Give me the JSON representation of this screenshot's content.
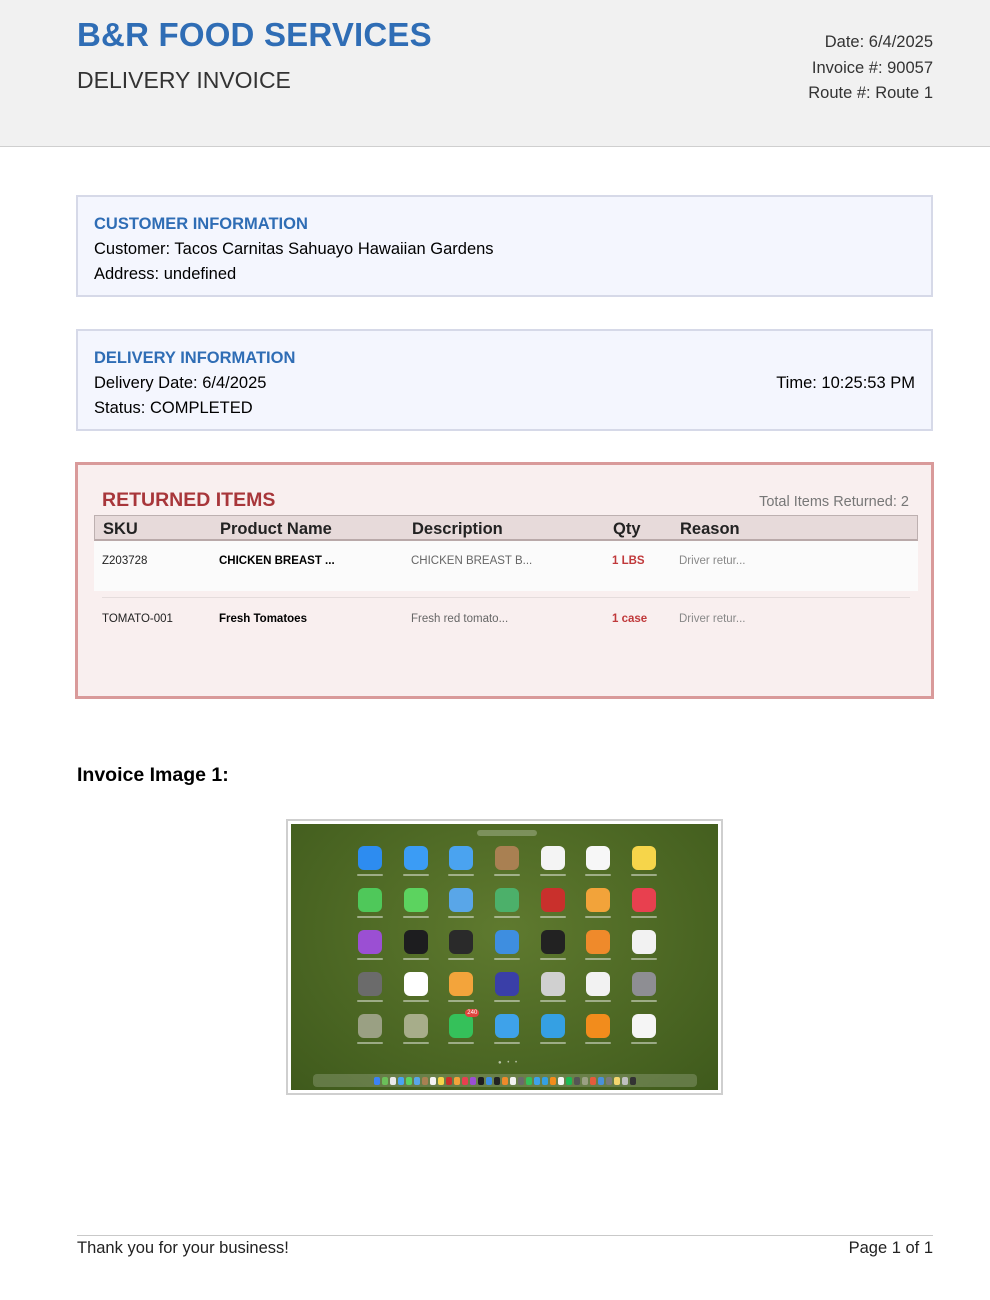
{
  "header": {
    "company": "B&R FOOD SERVICES",
    "document_type": "DELIVERY INVOICE",
    "date": "Date: 6/4/2025",
    "invoice": "Invoice #: 90057",
    "route": "Route #: Route 1"
  },
  "customer_info": {
    "title": "CUSTOMER INFORMATION",
    "customer": "Customer: Tacos  Carnitas Sahuayo Hawaiian Gardens",
    "address": "Address: undefined"
  },
  "delivery_info": {
    "title": "DELIVERY INFORMATION",
    "delivery_date": "Delivery Date: 6/4/2025",
    "time": "Time: 10:25:53 PM",
    "status": "Status: COMPLETED"
  },
  "returned_items": {
    "title": "RETURNED ITEMS",
    "total": "Total Items Returned: 2",
    "columns": [
      "SKU",
      "Product Name",
      "Description",
      "Qty",
      "Reason"
    ],
    "rows": [
      {
        "sku": "Z203728",
        "product": "CHICKEN BREAST ...",
        "description": "CHICKEN BREAST B...",
        "qty": "1 LBS",
        "reason": "Driver retur..."
      },
      {
        "sku": "TOMATO-001",
        "product": "Fresh Tomatoes",
        "description": "Fresh red tomato...",
        "qty": "1 case",
        "reason": "Driver retur..."
      }
    ]
  },
  "invoice_images": {
    "heading": "Invoice Image 1:",
    "app_icons": [
      "app-store-icon",
      "safari-icon",
      "mail-icon",
      "contacts-icon",
      "calendar-icon",
      "reminders-icon",
      "notes-icon",
      "facetime-icon",
      "messages-icon",
      "maps-icon",
      "find-my-icon",
      "photo-booth-icon",
      "photos-icon",
      "music-icon",
      "podcasts-icon",
      "tv-icon",
      "voice-memos-icon",
      "weather-icon",
      "stocks-icon",
      "books-icon",
      "clock-icon",
      "calculator-icon",
      "freeform-icon",
      "home-icon",
      "siri-icon",
      "iphone-mirroring-icon",
      "passwords-icon",
      "system-settings-icon",
      "other-folder-icon",
      "games-folder-icon",
      "whatsapp-icon",
      "twitter-icon",
      "telegram-icon",
      "vlc-icon",
      "chrome-icon"
    ],
    "app_colors": [
      "#2d8cf0",
      "#3b9cf5",
      "#4aa3f0",
      "#a98052",
      "#f4f4f4",
      "#f7f7f7",
      "#f6d54a",
      "#4fc85a",
      "#5cd35f",
      "#59a6e8",
      "#4cb06a",
      "#c9302c",
      "#f2a33a",
      "#e8404f",
      "#9b4fd3",
      "#1d1d1f",
      "#2a2a2a",
      "#3e8ee0",
      "#222222",
      "#ef8a2b",
      "#f2f2f2",
      "#6b6b6b",
      "#ffffff",
      "#f3a43b",
      "#3a3fa8",
      "#d0d0d0",
      "#f2f2f2",
      "#8e8e93",
      "#9aa083",
      "#a7ad8a",
      "#35c15a",
      "#3ea2ea",
      "#35a0e3",
      "#f28c1c",
      "#f5f5f5"
    ],
    "whatsapp_badge": "240",
    "dock_colors": [
      "#3b82f6",
      "#6bbf59",
      "#eaeaea",
      "#4aa3f0",
      "#5cd35f",
      "#59a6e8",
      "#a98052",
      "#f4f4f4",
      "#f6d54a",
      "#c9302c",
      "#f2a33a",
      "#e8404f",
      "#9b4fd3",
      "#1d1d1f",
      "#3e8ee0",
      "#222222",
      "#ef8a2b",
      "#f2f2f2",
      "#6b6b6b",
      "#35c15a",
      "#3ea2ea",
      "#35a0e3",
      "#f28c1c",
      "#f5f5f5",
      "#1db954",
      "#555555",
      "#9aa083",
      "#e55b3c",
      "#4a90d9",
      "#7a7a7a",
      "#f5d76e",
      "#c0c0c0",
      "#333333"
    ]
  },
  "footer": {
    "thanks": "Thank you for your business!",
    "page": "Page 1 of 1"
  }
}
